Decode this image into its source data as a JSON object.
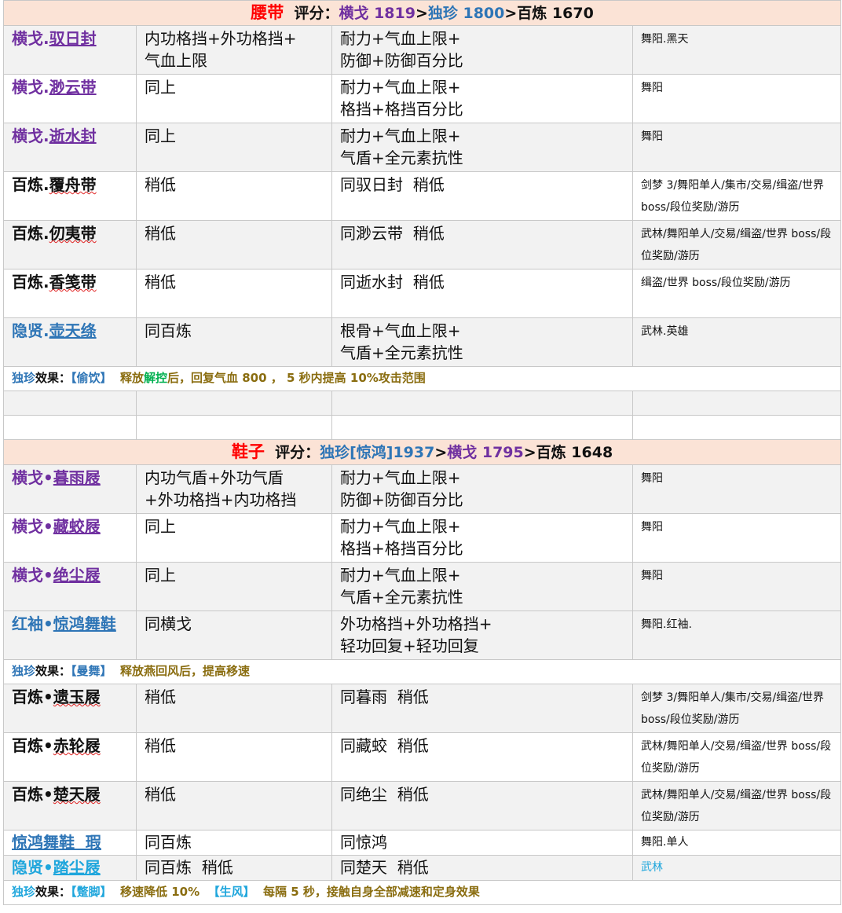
{
  "belt": {
    "header": [
      {
        "t": "腰带",
        "c": "red"
      },
      {
        "t": "  评分：",
        "c": "black"
      },
      {
        "t": "横戈 1819",
        "c": "purple"
      },
      {
        "t": ">",
        "c": "black"
      },
      {
        "t": "独珍 1800",
        "c": "blue"
      },
      {
        "t": ">百炼 1670",
        "c": "black"
      }
    ],
    "rows": [
      {
        "prefix": "横戈.",
        "name": "驭日封",
        "color": "purple",
        "attr": "内功格挡+外功格挡+\n气血上限",
        "stats": "耐力+气血上限+\n防御+防御百分比",
        "source": "舞阳.黑天"
      },
      {
        "prefix": "横戈.",
        "name": "渺云带",
        "color": "purple",
        "attr": "同上",
        "stats": "耐力+气血上限+\n格挡+格挡百分比",
        "source": "舞阳"
      },
      {
        "prefix": "横戈.",
        "name": "逝水封",
        "color": "purple",
        "attr": "同上",
        "stats": "耐力+气血上限+\n气盾+全元素抗性",
        "source": "舞阳"
      },
      {
        "prefix": "百炼.",
        "name": "覆舟带",
        "color": "black",
        "attr": "稍低",
        "stats": "同驭日封  稍低",
        "source": "剑梦 3/舞阳单人/集市/交易/缉盗/世界 boss/段位奖励/游历"
      },
      {
        "prefix": "百炼.",
        "name": "仞夷带",
        "color": "black",
        "attr": "稍低",
        "stats": "同渺云带  稍低",
        "source": "武林/舞阳单人/交易/缉盗/世界 boss/段位奖励/游历"
      },
      {
        "prefix": "百炼.",
        "name": "香笺带",
        "color": "black",
        "attr": "稍低",
        "stats": "同逝水封  稍低",
        "source": "缉盗/世界 boss/段位奖励/游历"
      },
      {
        "prefix": "隐贤.",
        "name": "壶天绦",
        "color": "blue",
        "attr": "同百炼",
        "stats": "根骨+气血上限+\n气盾+全元素抗性",
        "source": "武林.英雄"
      }
    ],
    "effect": [
      {
        "t": "独珍",
        "c": "blue"
      },
      {
        "t": "效果：",
        "c": "black"
      },
      {
        "t": "【偷饮】 ",
        "c": "blue"
      },
      {
        "t": " 释放",
        "c": "gold"
      },
      {
        "t": "解控",
        "c": "green"
      },
      {
        "t": "后，回复气血 800 ， 5 秒内提高 10%攻击范围",
        "c": "gold"
      }
    ]
  },
  "shoes": {
    "header": [
      {
        "t": "鞋子",
        "c": "red"
      },
      {
        "t": "  评分：",
        "c": "black"
      },
      {
        "t": "独珍[惊鸿]1937",
        "c": "blue"
      },
      {
        "t": ">",
        "c": "black"
      },
      {
        "t": "横戈 1795",
        "c": "purple"
      },
      {
        "t": ">百炼 1648",
        "c": "black"
      }
    ],
    "rows": [
      {
        "prefix": "横戈•",
        "name": "暮雨屐",
        "color": "purple",
        "attr": "内功气盾+外功气盾\n+外功格挡+内功格挡",
        "stats": "耐力+气血上限+\n防御+防御百分比",
        "source": "舞阳"
      },
      {
        "prefix": "横戈•",
        "name": "藏蛟屐",
        "color": "purple",
        "attr": "同上",
        "stats": "耐力+气血上限+\n格挡+格挡百分比",
        "source": "舞阳"
      },
      {
        "prefix": "横戈•",
        "name": "绝尘屐",
        "color": "purple",
        "attr": "同上",
        "stats": "耐力+气血上限+\n气盾+全元素抗性",
        "source": "舞阳"
      },
      {
        "prefix": "红袖•",
        "name": "惊鸿舞鞋",
        "color": "blue",
        "attr": "同横戈",
        "stats": "外功格挡+外功格挡+\n轻功回复+轻功回复",
        "source": "舞阳.红袖."
      }
    ],
    "effect1": [
      {
        "t": "独珍",
        "c": "blue"
      },
      {
        "t": "效果：",
        "c": "black"
      },
      {
        "t": "【曼舞】 ",
        "c": "blue"
      },
      {
        "t": " 释放燕回风后，提高移速",
        "c": "gold"
      }
    ],
    "rows2": [
      {
        "prefix": "百炼•",
        "name": "遗玉屐",
        "color": "black",
        "attr": "稍低",
        "stats": "同暮雨  稍低",
        "source": "剑梦 3/舞阳单人/集市/交易/缉盗/世界 boss/段位奖励/游历"
      },
      {
        "prefix": "百炼•",
        "name": "赤轮屐",
        "color": "black",
        "attr": "稍低",
        "stats": "同藏蛟  稍低",
        "source": "武林/舞阳单人/交易/缉盗/世界 boss/段位奖励/游历"
      },
      {
        "prefix": "百炼•",
        "name": "楚天屐",
        "color": "black",
        "attr": "稍低",
        "stats": "同绝尘  稍低",
        "source": "武林/舞阳单人/交易/缉盗/世界 boss/段位奖励/游历"
      },
      {
        "prefix": "",
        "name": "惊鸿舞鞋  瑕",
        "color": "blue",
        "attr": "同百炼",
        "stats": "同惊鸿",
        "source": "舞阳.单人"
      },
      {
        "prefix": "隐贤•",
        "name": "踏尘屐",
        "color": "cyan",
        "attr": "同百炼  稍低",
        "stats": "同楚天  稍低",
        "source": "武林"
      }
    ],
    "effect2": [
      {
        "t": "独珍",
        "c": "cyan"
      },
      {
        "t": "效果：",
        "c": "black"
      },
      {
        "t": "【蹩脚】 ",
        "c": "cyan"
      },
      {
        "t": " 移速降低 10%  ",
        "c": "gold"
      },
      {
        "t": "【生风】 ",
        "c": "cyan"
      },
      {
        "t": " 每隔 5 秒，接触自身全部减速和定身效果",
        "c": "gold"
      }
    ]
  }
}
